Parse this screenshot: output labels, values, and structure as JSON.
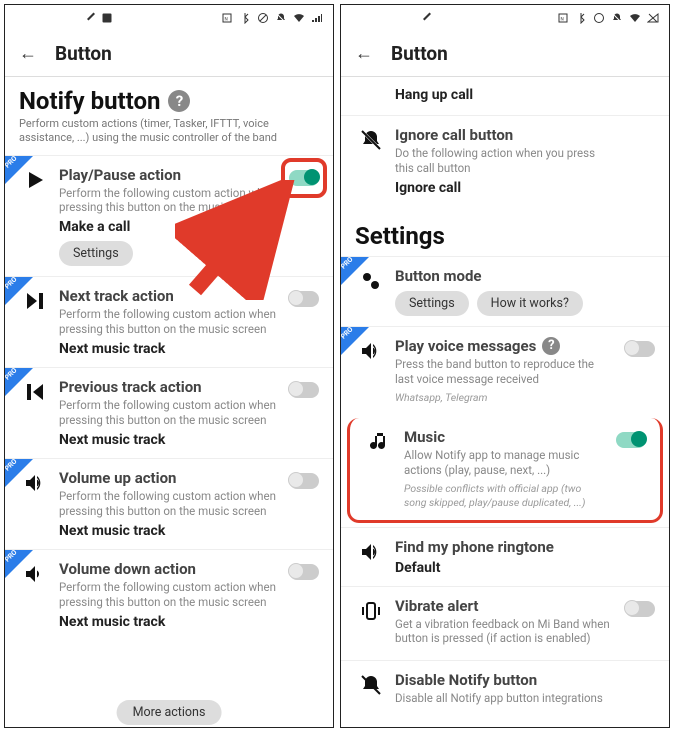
{
  "left": {
    "appbar": {
      "title": "Button"
    },
    "section": {
      "title": "Notify button",
      "sub": "Perform custom actions (timer, Tasker, IFTTT, voice assistance, ...) using the music controller of the band"
    },
    "play": {
      "title": "Play/Pause action",
      "sub": "Perform the following custom action when pressing this button on the music screen",
      "value": "Make a call",
      "settings": "Settings",
      "on": true
    },
    "next": {
      "title": "Next track action",
      "sub": "Perform the following custom action when pressing this button on the music screen",
      "value": "Next music track",
      "on": false
    },
    "prev": {
      "title": "Previous track action",
      "sub": "Perform the following custom action when pressing this button on the music screen",
      "value": "Next music track",
      "on": false
    },
    "volup": {
      "title": "Volume up action",
      "sub": "Perform the following custom action when pressing this button on the music screen",
      "value": "Next music track",
      "on": false
    },
    "voldown": {
      "title": "Volume down action",
      "sub": "Perform the following custom action when pressing this button on the music screen",
      "value": "Next music track",
      "on": false
    },
    "more": "More actions"
  },
  "right": {
    "appbar": {
      "title": "Button"
    },
    "hangup": {
      "value": "Hang up call"
    },
    "ignore": {
      "title": "Ignore call button",
      "sub": "Do the following action when you press this call button",
      "value": "Ignore call"
    },
    "settingsHeading": "Settings",
    "mode": {
      "title": "Button mode",
      "settings": "Settings",
      "how": "How it works?"
    },
    "voice": {
      "title": "Play voice messages",
      "sub": "Press the band button to reproduce the last voice message received",
      "apps": "Whatsapp, Telegram",
      "on": false
    },
    "music": {
      "title": "Music",
      "sub": "Allow Notify app to manage music actions (play, pause, next, ...)",
      "note": "Possible conflicts with official app (two song skipped, play/pause duplicated, ...)",
      "on": true
    },
    "ringtone": {
      "title": "Find my phone ringtone",
      "value": "Default"
    },
    "vibrate": {
      "title": "Vibrate alert",
      "sub": "Get a vibration feedback on Mi Band when button is pressed (if action is enabled)",
      "on": false
    },
    "disable": {
      "title": "Disable Notify button",
      "sub": "Disable all Notify app button integrations"
    }
  }
}
